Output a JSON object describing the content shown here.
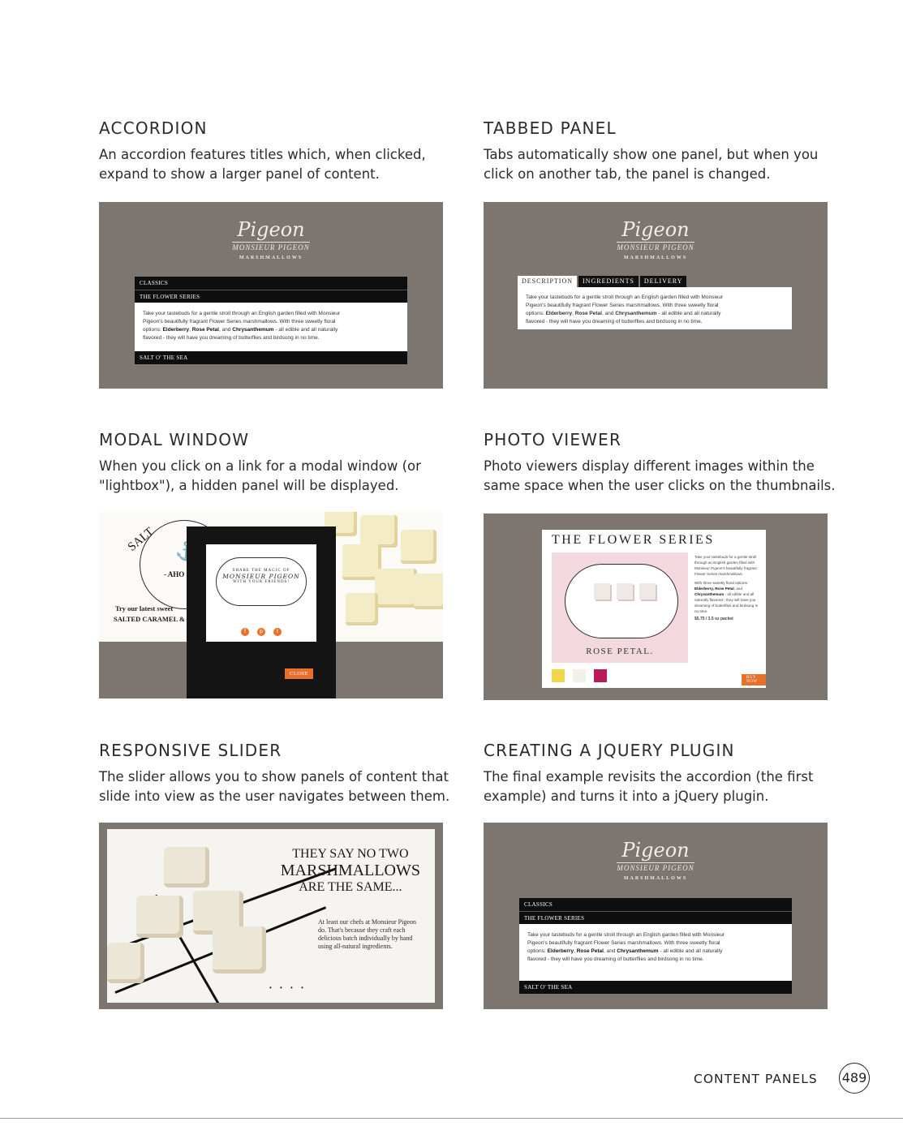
{
  "sections": {
    "accordion": {
      "title": "ACCORDION",
      "desc_line1": "An accordion features titles which, when clicked,",
      "desc_line2": "expand to show a larger panel of content."
    },
    "tabbed": {
      "title": "TABBED PANEL",
      "desc_line1": "Tabs automatically show one panel, but when you",
      "desc_line2": "click on another tab, the panel is changed."
    },
    "modal": {
      "title": "MODAL WINDOW",
      "desc_line1": "When you click on a link for a modal window (or",
      "desc_line2": "\"lightbox\"), a hidden panel will be displayed."
    },
    "photo": {
      "title": "PHOTO VIEWER",
      "desc_line1": "Photo viewers display different images within the",
      "desc_line2": "same space when the user clicks on the thumbnails."
    },
    "slider": {
      "title": "RESPONSIVE SLIDER",
      "desc_line1": "The slider allows you to show panels of content that",
      "desc_line2": "slide into view as the user navigates between them."
    },
    "plugin": {
      "title": "CREATING A JQUERY PLUGIN",
      "desc_line1": "The final example revisits the accordion (the first",
      "desc_line2": "example) and turns it into a jQuery plugin."
    }
  },
  "logo": {
    "script": "Pigeon",
    "sub": "MONSIEUR PIGEON",
    "tag": "MARSHMALLOWS"
  },
  "accordion_demo": {
    "bar1": "CLASSICS",
    "bar2": "THE FLOWER SERIES",
    "bar3": "SALT O' THE SEA",
    "p1": "Take your tastebuds for a gentle stroll through an English garden filled with Monsieur",
    "p2": "Pigeon's beautifully fragrant Flower Series marshmallows. With three sweetly floral",
    "p3a": "options: ",
    "e1": "Elderberry",
    "c1": ", ",
    "e2": "Rose Petal",
    "c2": ", and ",
    "e3": "Chrysanthemum",
    "p3b": " - all edible and all naturally",
    "p4": "flavored - they will have you dreaming of butterflies and birdsong in no time."
  },
  "tabs_demo": {
    "tab1": "DESCRIPTION",
    "tab2": "INGREDIENTS",
    "tab3": "DELIVERY"
  },
  "modal_demo": {
    "salt_word": "SALT O' THE SEA",
    "ahoy": "- AHO",
    "try": "Try our latest sweet",
    "salted": "SALTED CARAMEL &",
    "share": "SHARE THE MAGIC OF",
    "monsieur": "MONSIEUR PIGEON",
    "with": "WITH YOUR FRIENDS!",
    "close": "CLOSE"
  },
  "photo_demo": {
    "title": "THE FLOWER SERIES",
    "caption": "ROSE PETAL.",
    "side1": "Take your tastebuds for a gentle stroll through an English garden filled with Monsieur Pigeon's beautifully fragrant Flower Series marshmallows.",
    "side2a": "With three sweetly floral options: ",
    "side2b": "Elderberry, Rose Petal",
    "side2c": ", and ",
    "side2d": "Chrysanthemum",
    "side2e": " - all edible and all naturally flavored - they will have you dreaming of butterflies and birdsong in no time.",
    "price": "$5.75 / 3.5 oz packet",
    "buy": "BUY NOW"
  },
  "slider_demo": {
    "l1": "THEY SAY NO TWO",
    "l2": "MARSHMALLOWS",
    "l3": "ARE THE SAME...",
    "body": "At least our chefs at Monsieur Pigeon do. That's because they craft each delicious batch individually by hand using all-natural ingredients.",
    "dots": "• • • •"
  },
  "footer": {
    "label": "CONTENT PANELS",
    "page": "489"
  },
  "colors": {
    "panel_gray": "#7d7670",
    "accent_orange": "#e8702a",
    "bar_black": "#0e0e0e"
  }
}
